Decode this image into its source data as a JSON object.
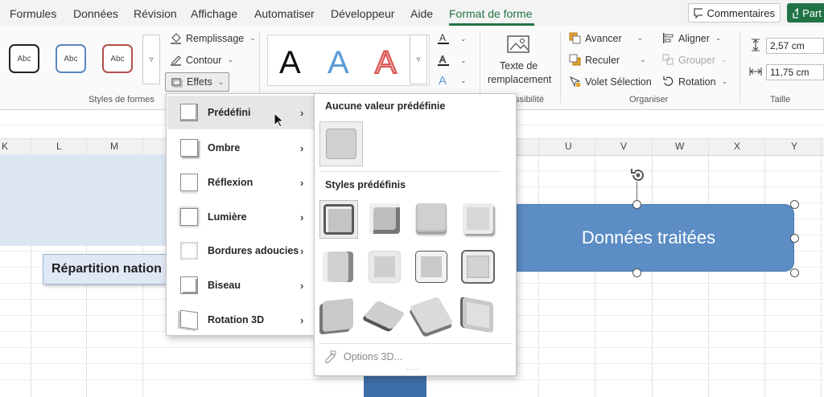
{
  "menubar": {
    "tabs": [
      "Formules",
      "Données",
      "Révision",
      "Affichage",
      "Automatiser",
      "Développeur",
      "Aide",
      "Format de forme"
    ],
    "active_tab": "Format de forme",
    "comments_label": "Commentaires",
    "share_label": "Part"
  },
  "ribbon": {
    "shape_styles": {
      "sample": "Abc",
      "fill_label": "Remplissage",
      "outline_label": "Contour",
      "effects_label": "Effets",
      "group_label": "Styles de formes"
    },
    "wordart": {
      "letter": "A"
    },
    "accessibility": {
      "alt_text_line1": "Texte de",
      "alt_text_line2": "remplacement",
      "group_label_partial": "ssibilité"
    },
    "arrange": {
      "forward_label": "Avancer",
      "backward_label": "Reculer",
      "selection_pane_label": "Volet Sélection",
      "align_label": "Aligner",
      "group_btn_label": "Grouper",
      "rotate_label": "Rotation",
      "group_label": "Organiser"
    },
    "size": {
      "height_value": "2,57 cm",
      "width_value": "11,75 cm",
      "group_label": "Taille"
    }
  },
  "sheet": {
    "columns_left": [
      "K",
      "L",
      "M"
    ],
    "columns_right": [
      "U",
      "V",
      "W",
      "X",
      "Y"
    ],
    "repartition_text": "Répartition nation",
    "shape_text": "Données traitées"
  },
  "effects_menu": {
    "items": [
      {
        "label": "Prédéfini"
      },
      {
        "label": "Ombre"
      },
      {
        "label": "Réflexion"
      },
      {
        "label": "Lumière"
      },
      {
        "label": "Bordures adoucies"
      },
      {
        "label": "Biseau"
      },
      {
        "label": "Rotation 3D"
      }
    ]
  },
  "preset_panel": {
    "no_preset_heading": "Aucune valeur prédéfinie",
    "presets_heading": "Styles prédéfinis",
    "options_3d_label": "Options 3D..."
  },
  "colors": {
    "accent_green": "#217346",
    "shape_blue": "#5c8dc5",
    "wordart_blue": "#5b9bd5",
    "wordart_red": "#e06666"
  }
}
